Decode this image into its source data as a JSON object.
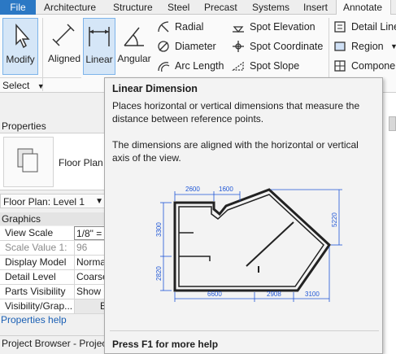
{
  "tabs": [
    {
      "label": "File"
    },
    {
      "label": "Architecture"
    },
    {
      "label": "Structure"
    },
    {
      "label": "Steel"
    },
    {
      "label": "Precast"
    },
    {
      "label": "Systems"
    },
    {
      "label": "Insert"
    },
    {
      "label": "Annotate"
    }
  ],
  "ribbon": {
    "modify": "Modify",
    "select": "Select",
    "aligned": "Aligned",
    "linear": "Linear",
    "angular": "Angular",
    "radial": "Radial",
    "diameter": "Diameter",
    "arc_length": "Arc  Length",
    "spot_elevation": "Spot  Elevation",
    "spot_coordinate": "Spot  Coordinate",
    "spot_slope": "Spot  Slope",
    "detail_line": "Detail  Line",
    "region": "Region",
    "component": "Componen"
  },
  "properties": {
    "header": "Properties",
    "type_name": "Floor Plan",
    "level_selector": "Floor Plan: Level 1",
    "group": "Graphics",
    "rows": [
      {
        "key": "View Scale",
        "value": "1/8\" ="
      },
      {
        "key": "Scale Value  1:",
        "value": "96"
      },
      {
        "key": "Display Model",
        "value": "Norma"
      },
      {
        "key": "Detail Level",
        "value": "Coarse"
      },
      {
        "key": "Parts Visibility",
        "value": "Show O"
      },
      {
        "key": "Visibility/Grap...",
        "value": "E"
      }
    ],
    "help_link": "Properties help",
    "browser_title": "Project Browser - Project"
  },
  "tooltip": {
    "title": "Linear Dimension",
    "p1": "Places horizontal or vertical dimensions that measure the distance between reference points.",
    "p2": "The dimensions are aligned with the horizontal or vertical axis of the view.",
    "help": "Press F1 for more help",
    "dims": {
      "top_a": "2600",
      "top_b": "1600",
      "left_a": "3300",
      "left_b": "2820",
      "right": "5220",
      "bottom_a": "6600",
      "bottom_b": "2908",
      "bottom_c": "3100"
    }
  },
  "colors": {
    "file_tab": "#2b78c4",
    "dimension_blue": "#1f56d6",
    "pressed_button": "#d5e6f7",
    "link": "#1a5fb4"
  }
}
